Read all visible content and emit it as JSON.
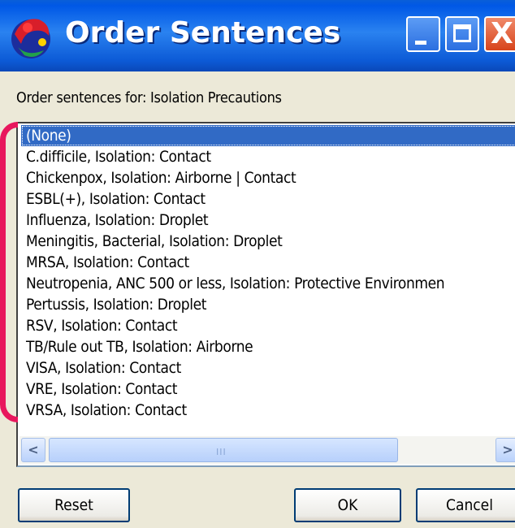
{
  "window": {
    "title": "Order Sentences"
  },
  "titlebar_buttons": {
    "close_glyph": "X"
  },
  "prompt": {
    "label": "Order sentences for:  Isolation Precautions"
  },
  "list": {
    "items": [
      "(None)",
      "C.difficile, Isolation: Contact",
      "Chickenpox, Isolation: Airborne | Contact",
      "ESBL(+), Isolation: Contact",
      "Influenza, Isolation: Droplet",
      "Meningitis, Bacterial, Isolation: Droplet",
      "MRSA, Isolation: Contact",
      "Neutropenia, ANC 500 or less, Isolation: Protective Environmen",
      "Pertussis, Isolation: Droplet",
      "RSV, Isolation: Contact",
      "TB/Rule out TB, Isolation: Airborne",
      "VISA, Isolation: Contact",
      "VRE, Isolation: Contact",
      "VRSA, Isolation: Contact"
    ],
    "selected_index": 0
  },
  "scrollbar": {
    "left_arrow": "<",
    "right_arrow": ">",
    "grip": "III"
  },
  "buttons": {
    "reset": "Reset",
    "ok": "OK",
    "cancel": "Cancel"
  },
  "colors": {
    "title_bar": "#0058e6",
    "selection": "#316ac5",
    "annotation": "#e8175d"
  }
}
